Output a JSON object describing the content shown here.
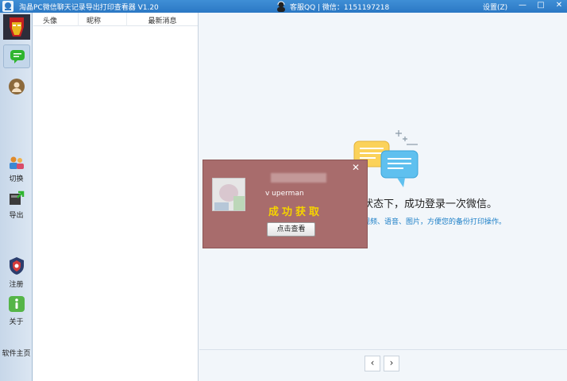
{
  "titlebar": {
    "title": "淘晶PC微信聊天记录导出打印查看器 V1.20",
    "support": "客服QQ | 微信：1151197218",
    "settings": "设置(Z)",
    "min": "—",
    "max": "□",
    "close": "✕"
  },
  "rail": {
    "switch_label": "切换",
    "export_label": "导出",
    "register_label": "注册",
    "about_label": "关于",
    "homepage_label": "软件主页"
  },
  "list": {
    "col_avatar": "头像",
    "col_nickname": "昵称",
    "col_latest": "最新消息"
  },
  "main": {
    "welcome_line": "状态下，成功登录一次微信。",
    "welcome_sub": "视频、语音、图片，方便您的备份打印操作。"
  },
  "pager": {
    "prev": "‹",
    "next": "›"
  },
  "popup": {
    "close": "✕",
    "user_id": "v         uperman",
    "success": "成功获取",
    "view_button": "点击查看"
  },
  "colors": {
    "titlebar": "#2b78c4",
    "popup_bg": "#a86c6c",
    "success_text": "#f5d300",
    "link_blue": "#1c7fc7"
  }
}
